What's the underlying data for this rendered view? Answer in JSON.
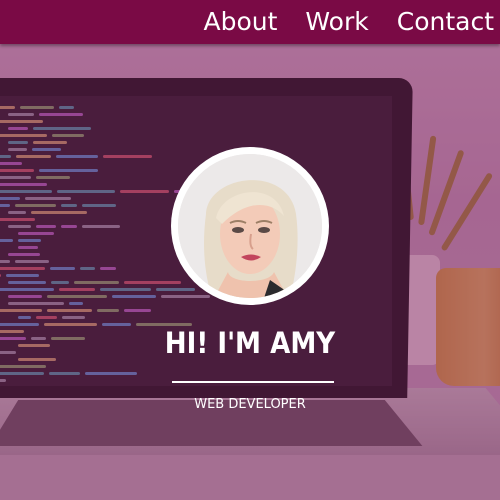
{
  "nav": {
    "items": [
      {
        "label": "About"
      },
      {
        "label": "Work"
      },
      {
        "label": "Contact"
      }
    ]
  },
  "hero": {
    "heading": "HI! I'M AMY",
    "subtitle": "WEB DEVELOPER",
    "avatar_icon": "profile-photo"
  },
  "colors": {
    "nav_background": "#7a0a45",
    "overlay": "#781450",
    "text": "#ffffff"
  }
}
